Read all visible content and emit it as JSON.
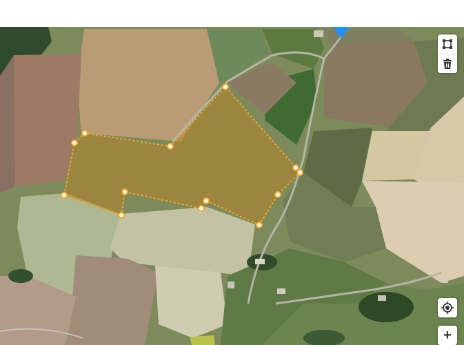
{
  "map": {
    "view": "satellite",
    "controls": {
      "draw_polygon": {
        "icon": "polygon-draw-icon"
      },
      "delete": {
        "icon": "trash-icon"
      },
      "geolocate": {
        "icon": "locate-icon"
      },
      "zoom_in": {
        "icon": "plus-icon",
        "label": "+"
      }
    },
    "colors": {
      "polygon_stroke": "#f5a623",
      "polygon_fill": "#c47f1a",
      "marker": "#1e90ff"
    }
  }
}
